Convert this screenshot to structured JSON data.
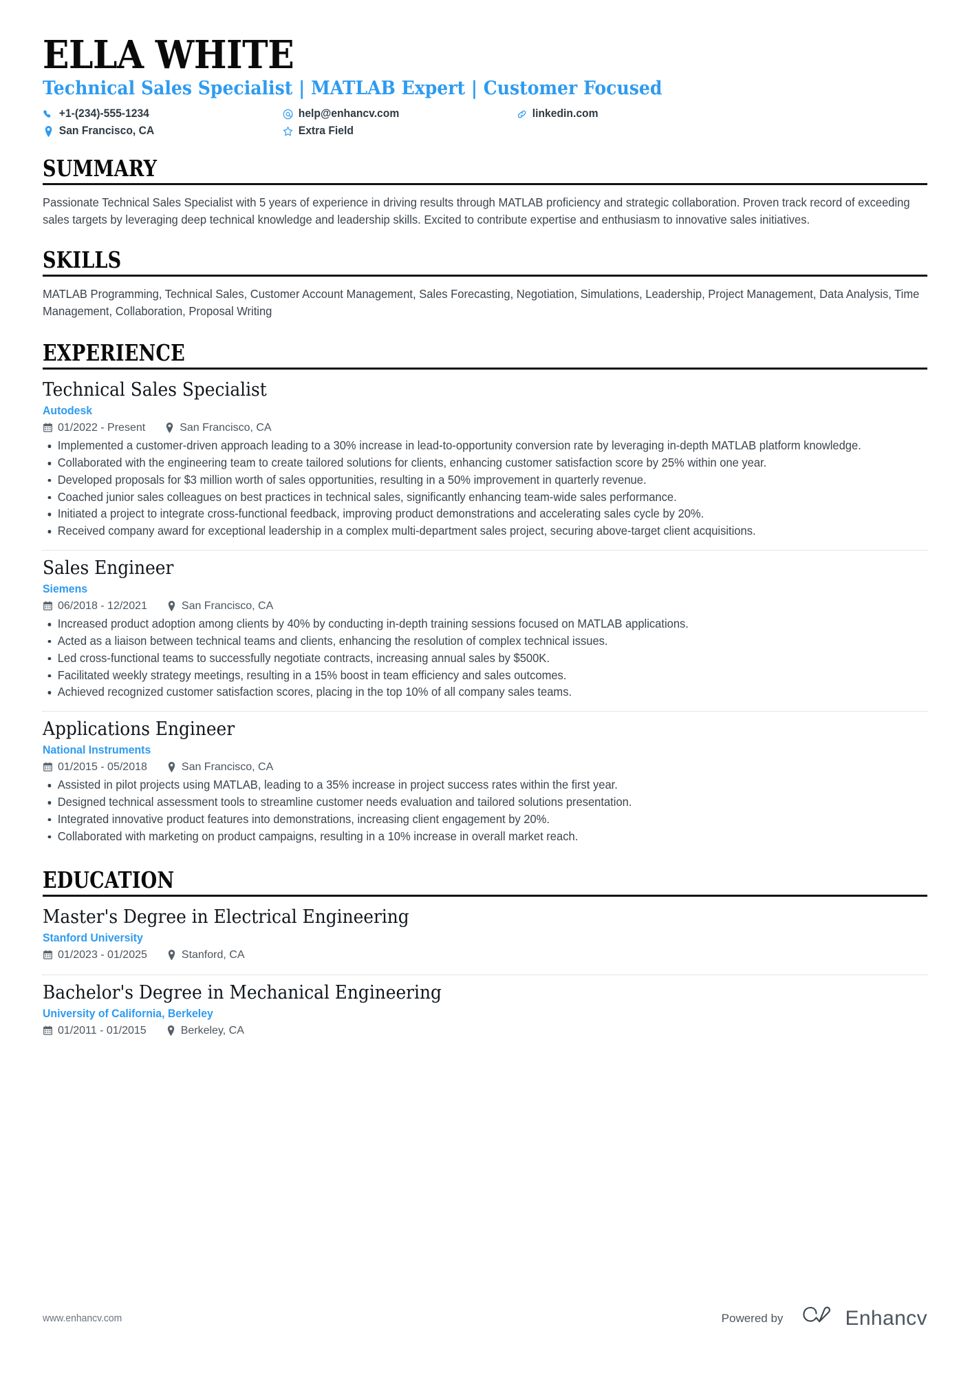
{
  "header": {
    "name": "ELLA WHITE",
    "headline": "Technical Sales Specialist | MATLAB Expert | Customer Focused",
    "contacts": [
      {
        "icon": "phone-icon",
        "text": "+1-(234)-555-1234"
      },
      {
        "icon": "email-icon",
        "text": "help@enhancv.com"
      },
      {
        "icon": "link-icon",
        "text": "linkedin.com"
      },
      {
        "icon": "location-icon",
        "text": "San Francisco, CA"
      },
      {
        "icon": "star-icon",
        "text": "Extra Field"
      }
    ]
  },
  "summary": {
    "heading": "SUMMARY",
    "text": "Passionate Technical Sales Specialist with 5 years of experience in driving results through MATLAB proficiency and strategic collaboration. Proven track record of exceeding sales targets by leveraging deep technical knowledge and leadership skills. Excited to contribute expertise and enthusiasm to innovative sales initiatives."
  },
  "skills": {
    "heading": "SKILLS",
    "text": "MATLAB Programming, Technical Sales, Customer Account Management, Sales Forecasting, Negotiation, Simulations, Leadership, Project Management, Data Analysis, Time Management, Collaboration, Proposal Writing"
  },
  "experience": {
    "heading": "EXPERIENCE",
    "entries": [
      {
        "title": "Technical Sales Specialist",
        "org": "Autodesk",
        "dates": "01/2022 - Present",
        "location": "San Francisco, CA",
        "bullets": [
          "Implemented a customer-driven approach leading to a 30% increase in lead-to-opportunity conversion rate by leveraging in-depth MATLAB platform knowledge.",
          "Collaborated with the engineering team to create tailored solutions for clients, enhancing customer satisfaction score by 25% within one year.",
          "Developed proposals for $3 million worth of sales opportunities, resulting in a 50% improvement in quarterly revenue.",
          "Coached junior sales colleagues on best practices in technical sales, significantly enhancing team-wide sales performance.",
          "Initiated a project to integrate cross-functional feedback, improving product demonstrations and accelerating sales cycle by 20%.",
          "Received company award for exceptional leadership in a complex multi-department sales project, securing above-target client acquisitions."
        ]
      },
      {
        "title": "Sales Engineer",
        "org": "Siemens",
        "dates": "06/2018 - 12/2021",
        "location": "San Francisco, CA",
        "bullets": [
          "Increased product adoption among clients by 40% by conducting in-depth training sessions focused on MATLAB applications.",
          "Acted as a liaison between technical teams and clients, enhancing the resolution of complex technical issues.",
          "Led cross-functional teams to successfully negotiate contracts, increasing annual sales by $500K.",
          "Facilitated weekly strategy meetings, resulting in a 15% boost in team efficiency and sales outcomes.",
          "Achieved recognized customer satisfaction scores, placing in the top 10% of all company sales teams."
        ]
      },
      {
        "title": "Applications Engineer",
        "org": "National Instruments",
        "dates": "01/2015 - 05/2018",
        "location": "San Francisco, CA",
        "bullets": [
          "Assisted in pilot projects using MATLAB, leading to a 35% increase in project success rates within the first year.",
          "Designed technical assessment tools to streamline customer needs evaluation and tailored solutions presentation.",
          "Integrated innovative product features into demonstrations, increasing client engagement by 20%.",
          "Collaborated with marketing on product campaigns, resulting in a 10% increase in overall market reach."
        ]
      }
    ]
  },
  "education": {
    "heading": "EDUCATION",
    "entries": [
      {
        "title": "Master's Degree in Electrical Engineering",
        "org": "Stanford University",
        "dates": "01/2023 - 01/2025",
        "location": "Stanford, CA"
      },
      {
        "title": "Bachelor's Degree in Mechanical Engineering",
        "org": "University of California, Berkeley",
        "dates": "01/2011 - 01/2015",
        "location": "Berkeley, CA"
      }
    ]
  },
  "footer": {
    "url": "www.enhancv.com",
    "powered_by": "Powered by",
    "brand": "Enhancv"
  },
  "colors": {
    "accent": "#2e9bf0",
    "text": "#3a444d",
    "heading": "#0a0a0a",
    "rule": "#121212",
    "muted": "#4c565f"
  }
}
